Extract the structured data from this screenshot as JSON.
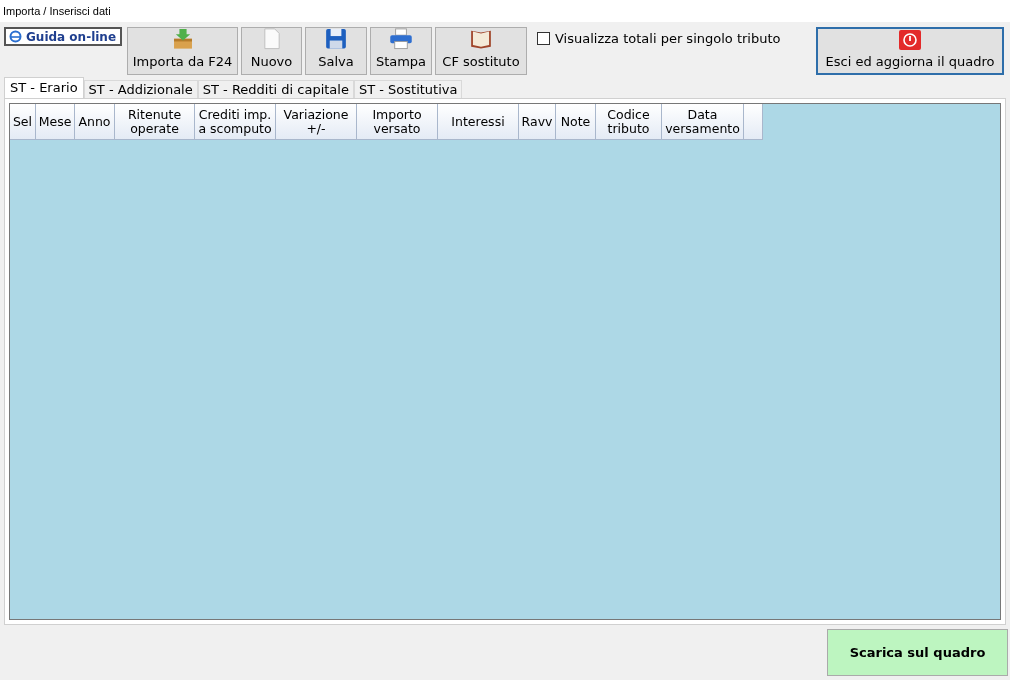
{
  "window": {
    "title": "Importa / Inserisci dati"
  },
  "help_button": {
    "label": "Guida on-line"
  },
  "toolbar": [
    {
      "label": "Importa da F24",
      "kind": "import"
    },
    {
      "label": "Nuovo",
      "kind": "new"
    },
    {
      "label": "Salva",
      "kind": "save"
    },
    {
      "label": "Stampa",
      "kind": "print"
    },
    {
      "label": "CF sostituto",
      "kind": "book"
    }
  ],
  "totals_checkbox": {
    "label": "Visualizza totali per singolo tributo",
    "checked": false
  },
  "exit_button": {
    "label": "Esci ed aggiorna il quadro"
  },
  "tabs": [
    {
      "label": "ST - Erario",
      "selected": true
    },
    {
      "label": "ST - Addizionale",
      "selected": false
    },
    {
      "label": "ST - Redditi di capitale",
      "selected": false
    },
    {
      "label": "ST - Sostitutiva",
      "selected": false
    }
  ],
  "table": {
    "columns": [
      "Sel",
      "Mese",
      "Anno",
      "Ritenute\noperate",
      "Crediti imp.\na scomputo",
      "Variazione\n+/-",
      "Importo\nversato",
      "Interessi",
      "Ravv",
      "Note",
      "Codice\ntributo",
      "Data\nversamento"
    ]
  },
  "download_button": {
    "label": "Scarica sul quadro"
  }
}
